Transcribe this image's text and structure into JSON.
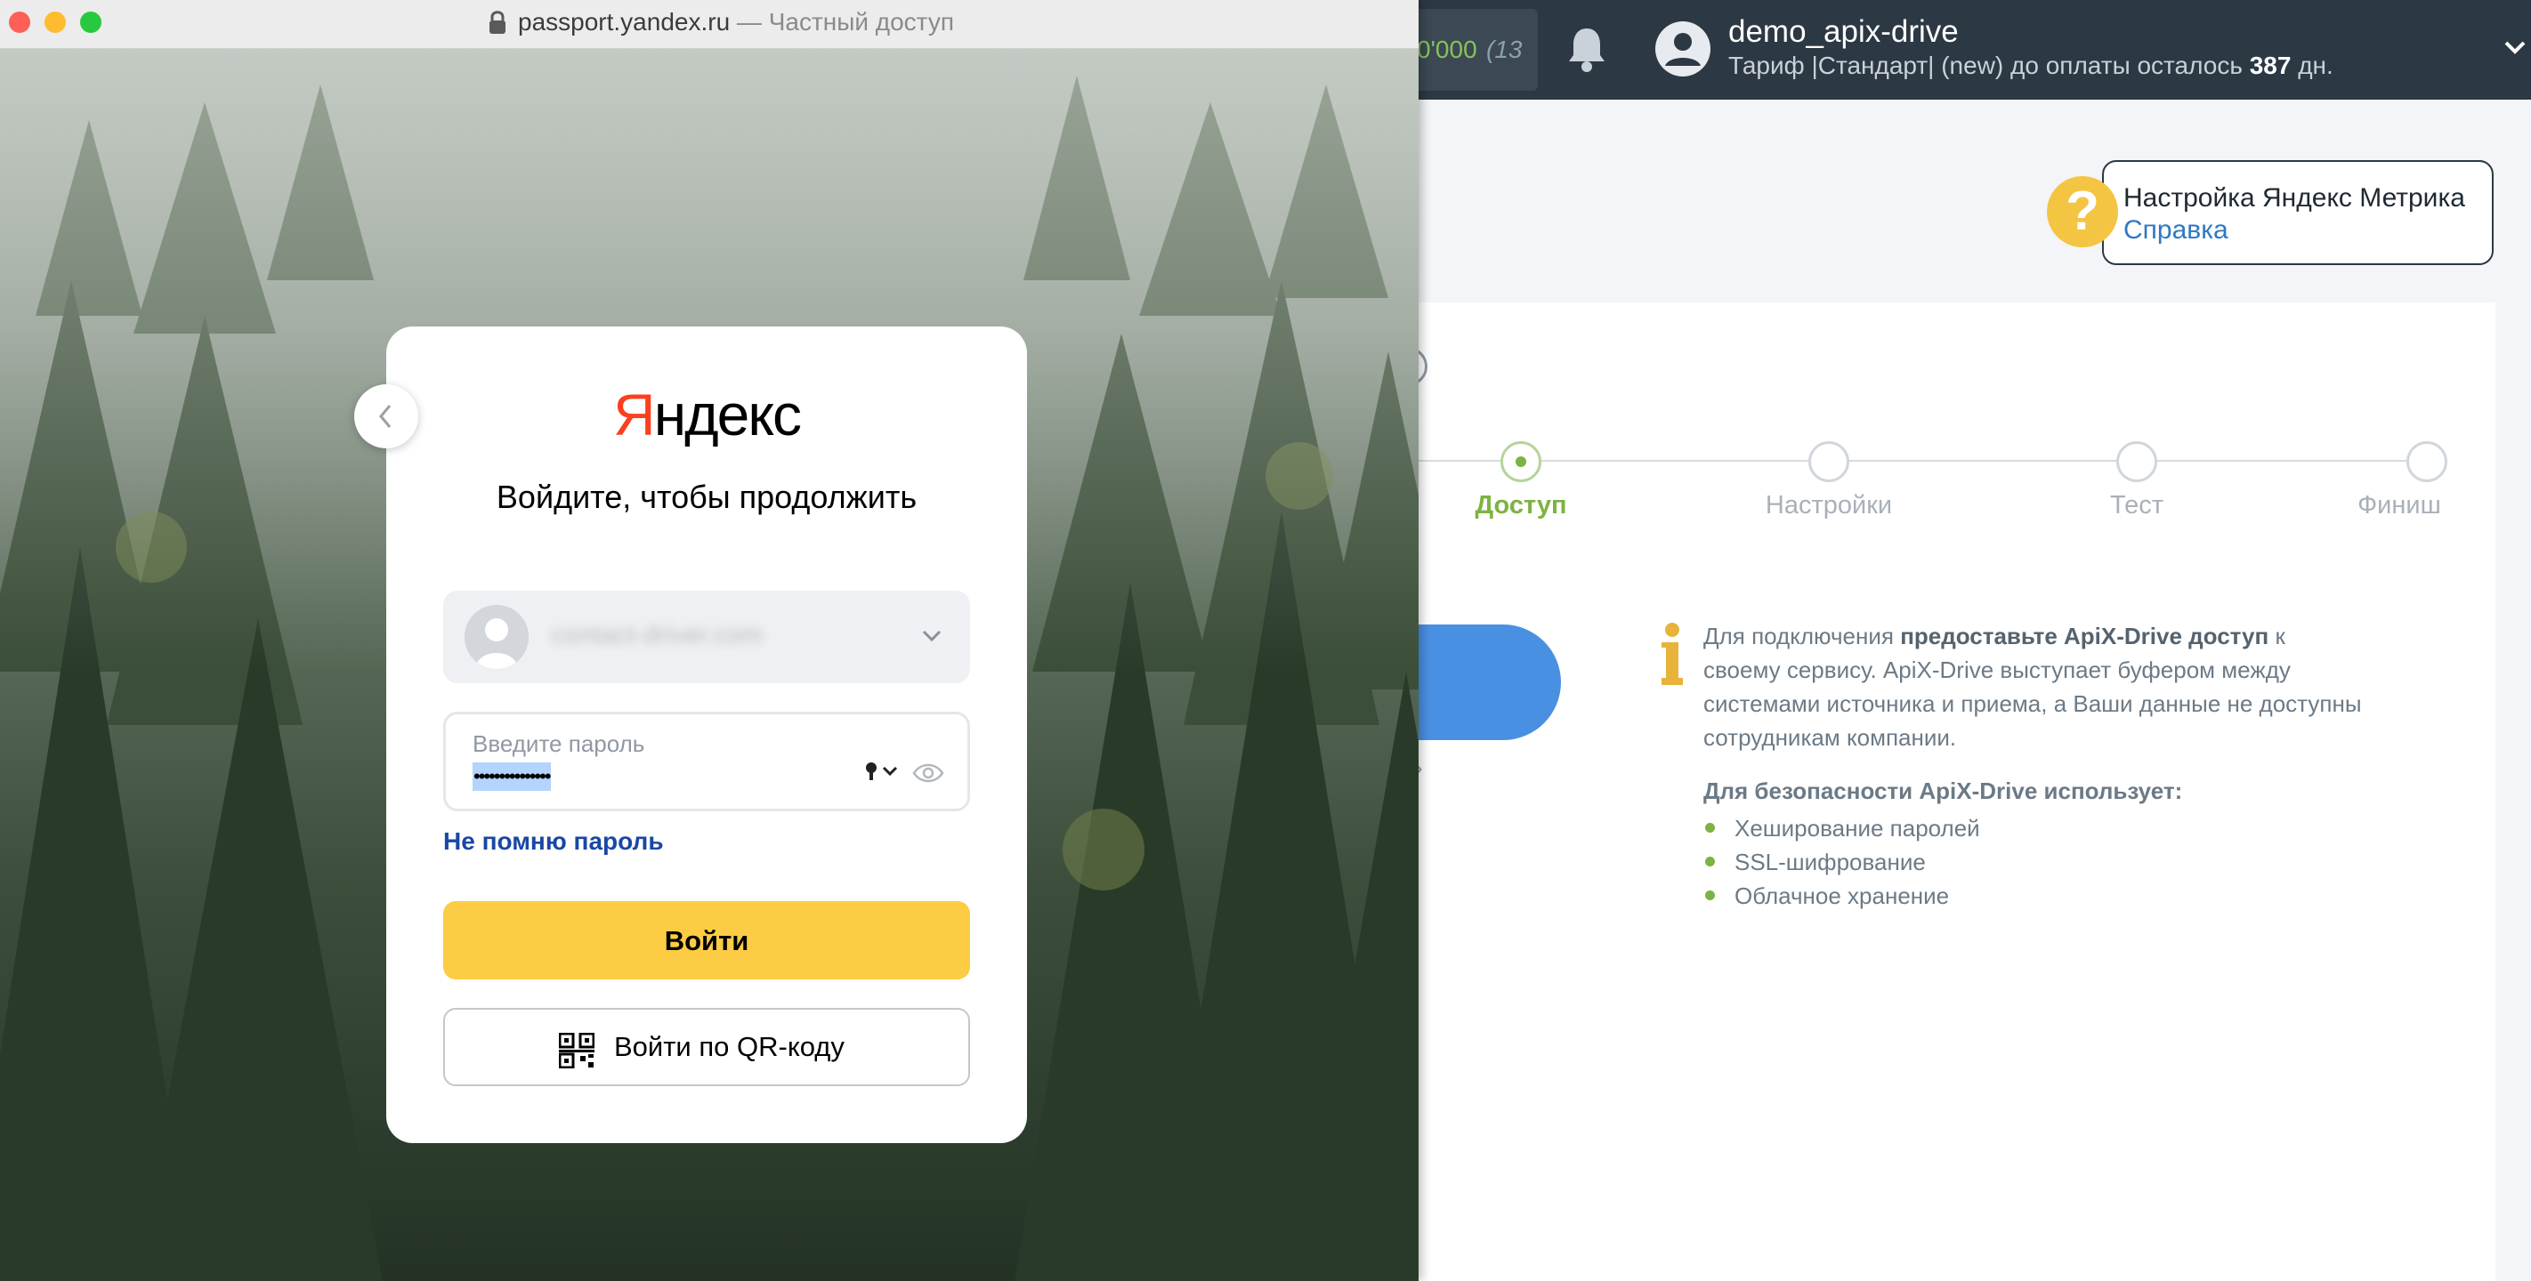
{
  "app": {
    "balance_value": "0'000",
    "balance_paren": "(13",
    "user_name": "demo_apix-drive",
    "tariff_prefix": "Тариф |Стандарт| (new) до оплаты осталось ",
    "tariff_days": "387",
    "tariff_suffix": " дн.",
    "help_title": "Настройка Яндекс Метрика",
    "help_link": "Справка",
    "steps": [
      {
        "label": "Доступ",
        "active": true
      },
      {
        "label": "Настройки",
        "active": false
      },
      {
        "label": "Тест",
        "active": false
      },
      {
        "label": "Финиш",
        "active": false
      }
    ],
    "link_fragment": "»",
    "info_prefix": "Для подключения ",
    "info_bold": "предоставьте ApiX-Drive доступ",
    "info_suffix": " к своему сервису. ApiX-Drive выступает буфером между системами источника и приема, а Ваши данные не доступны сотрудникам компании.",
    "security_title": "Для безопасности ApiX-Drive использует:",
    "security_items": [
      "Хеширование паролей",
      "SSL-шифрование",
      "Облачное хранение"
    ],
    "colors": {
      "header_bg": "#2c3843",
      "accent_green": "#7cb342",
      "blue_button": "#4a90e2",
      "help_yellow": "#f4c542"
    }
  },
  "browser": {
    "url": "passport.yandex.ru",
    "url_separator": " — ",
    "private_label": "Частный доступ"
  },
  "yandex": {
    "logo_ya": "Я",
    "logo_rest": "ндекс",
    "title": "Войдите, чтобы продолжить",
    "account_email": "contact-driver.com",
    "password_label": "Введите пароль",
    "password_value": "•••••••••••••••",
    "forgot_password": "Не помню пароль",
    "login_button": "Войти",
    "qr_button": "Войти по QR-коду",
    "colors": {
      "yellow_button": "#fccc45",
      "logo_red": "#fc3f1d",
      "link_blue": "#1a47a6"
    }
  },
  "icons": {
    "lock": "lock-icon",
    "bell": "bell-icon",
    "user": "user-avatar-icon",
    "back": "chevron-left-icon",
    "key": "key-icon",
    "eye": "eye-icon",
    "qr": "qr-code-icon",
    "info": "info-icon",
    "help": "question-icon"
  }
}
